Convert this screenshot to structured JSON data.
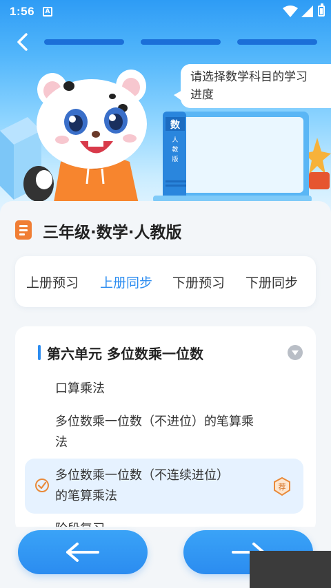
{
  "status_bar": {
    "time": "1:56",
    "app_indicator": "A",
    "icons": [
      "wifi-icon",
      "signal-icon",
      "battery-icon"
    ]
  },
  "header": {
    "back_icon": "chevron-left-icon",
    "progress_segments": 3,
    "speech_line1": "请选择数学科目的学习",
    "speech_line2": "进度",
    "book_spine_text": [
      "数",
      "人",
      "教",
      "版"
    ]
  },
  "grade": {
    "icon": "document-icon",
    "title": "三年级·数学·人教版"
  },
  "tabs": [
    {
      "label": "上册预习",
      "active": false
    },
    {
      "label": "上册同步",
      "active": true
    },
    {
      "label": "下册预习",
      "active": false
    },
    {
      "label": "下册同步",
      "active": false
    }
  ],
  "unit": {
    "title": "第六单元 多位数乘一位数",
    "toggle_icon": "chevron-down-icon",
    "lessons": [
      {
        "line1": "口算乘法",
        "line2": ""
      },
      {
        "line1": "多位数乘一位数（不进位）的笔算乘",
        "line2": "法"
      },
      {
        "line1": "多位数乘一位数（不连续进位）",
        "line2": "的笔算乘法",
        "selected": true,
        "badge": "荐"
      },
      {
        "line1": "阶段复习",
        "line2": ""
      }
    ]
  },
  "nav": {
    "prev_icon": "arrow-left-icon",
    "next_icon": "arrow-right-icon"
  },
  "colors": {
    "accent": "#2b8cf0",
    "header_top": "#2e9cf5",
    "grade_icon": "#f07e35",
    "highlight_bg": "#e6f2ff",
    "badge": "#e98a3a"
  }
}
